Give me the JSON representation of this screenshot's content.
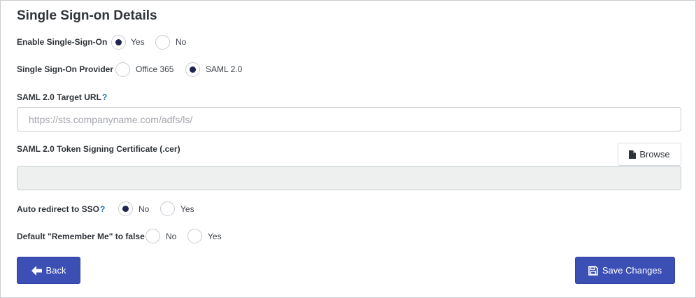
{
  "page": {
    "title": "Single Sign-on Details"
  },
  "enable_sso": {
    "label": "Enable Single-Sign-On",
    "options": [
      "Yes",
      "No"
    ],
    "selected": "Yes"
  },
  "provider": {
    "label": "Single Sign-On Provider",
    "options": [
      "Office 365",
      "SAML 2.0"
    ],
    "selected": "SAML 2.0"
  },
  "target_url": {
    "label": "SAML 2.0 Target URL",
    "help": "?",
    "value": "",
    "placeholder": "https://sts.companyname.com/adfs/ls/"
  },
  "certificate": {
    "label": "SAML 2.0 Token Signing Certificate (.cer)",
    "browse_label": "Browse",
    "browse_icon": "file-icon",
    "value": ""
  },
  "auto_redirect": {
    "label": "Auto redirect to SSO",
    "help": "?",
    "options": [
      "No",
      "Yes"
    ],
    "selected": "No"
  },
  "remember_me": {
    "label": "Default \"Remember Me\" to false",
    "options": [
      "No",
      "Yes"
    ],
    "selected": ""
  },
  "actions": {
    "back_label": "Back",
    "back_icon": "arrow-left-icon",
    "save_label": "Save Changes",
    "save_icon": "floppy-disk-icon",
    "primary_color": "#3b4fb5"
  },
  "colors": {
    "radio_checked": "#1f2451",
    "help": "#1f6fb8"
  }
}
